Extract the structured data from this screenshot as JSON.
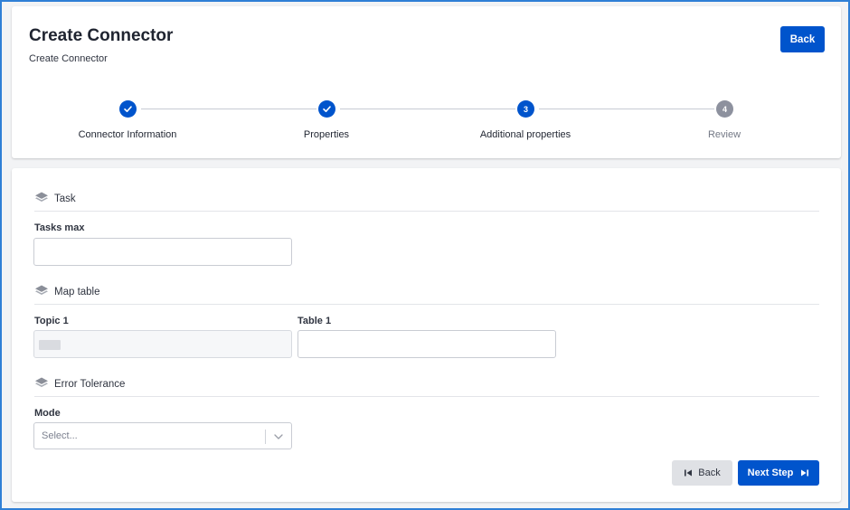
{
  "header": {
    "title": "Create Connector",
    "breadcrumb": "Create Connector",
    "back_label": "Back"
  },
  "stepper": {
    "steps": [
      {
        "label": "Connector Information",
        "status": "done",
        "number": ""
      },
      {
        "label": "Properties",
        "status": "done",
        "number": ""
      },
      {
        "label": "Additional properties",
        "status": "active",
        "number": "3"
      },
      {
        "label": "Review",
        "status": "todo",
        "number": "4"
      }
    ]
  },
  "sections": {
    "task": {
      "title": "Task",
      "tasks_max_label": "Tasks max",
      "tasks_max_value": ""
    },
    "map_table": {
      "title": "Map table",
      "topic_label": "Topic 1",
      "table_label": "Table 1",
      "table_value": ""
    },
    "error_tolerance": {
      "title": "Error Tolerance",
      "mode_label": "Mode",
      "mode_placeholder": "Select..."
    }
  },
  "footer": {
    "back_label": "Back",
    "next_label": "Next Step"
  },
  "icons": {
    "step_done": "check-icon",
    "section": "layers-icon",
    "select": "chevron-down-icon",
    "back": "skip-previous-icon",
    "next": "skip-next-icon"
  },
  "colors": {
    "primary": "#0054cc",
    "step_todo": "#8d919e",
    "frame_border": "#2f7fd6"
  }
}
